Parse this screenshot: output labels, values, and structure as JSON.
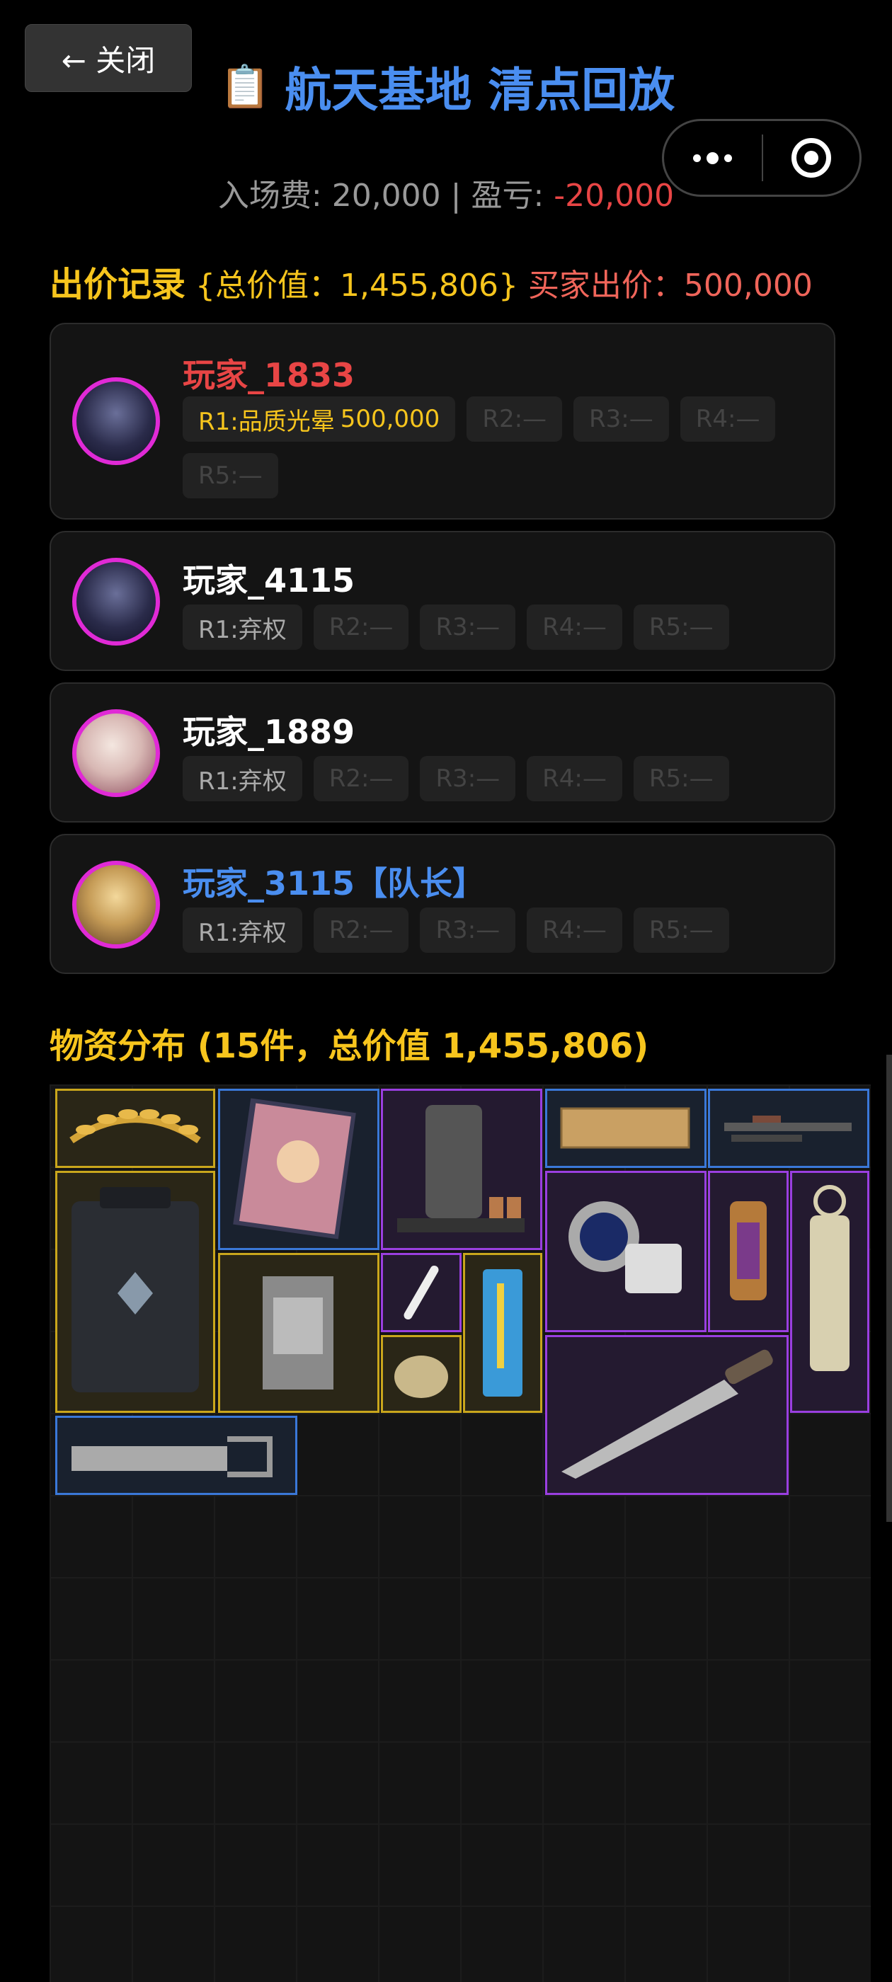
{
  "header": {
    "close_label": "← 关闭",
    "title_icon": "📋",
    "title": "航天基地 清点回放",
    "entry_fee_label": "入场费: 20,000 | 盈亏: ",
    "profit_loss": "-20,000"
  },
  "bids": {
    "heading": "出价记录",
    "total_value": "{总价值：1,455,806}",
    "buyer_bid": "买家出价：500,000",
    "players": [
      {
        "name": "玩家_1833",
        "avatar": "dark-hair-man-avatar",
        "rounds": [
          "R1:品质光晕",
          "500,000",
          "R2:—",
          "R3:—",
          "R4:—",
          "R5:—"
        ]
      },
      {
        "name": "玩家_4115",
        "avatar": "dark-hair-man-avatar",
        "rounds": [
          "R1:弃权",
          "R2:—",
          "R3:—",
          "R4:—",
          "R5:—"
        ]
      },
      {
        "name": "玩家_1889",
        "avatar": "white-hair-girl-avatar",
        "rounds": [
          "R1:弃权",
          "R2:—",
          "R3:—",
          "R4:—",
          "R5:—"
        ]
      },
      {
        "name": "玩家_3115【队长】",
        "avatar": "blonde-girl-avatar",
        "rounds": [
          "R1:弃权",
          "R2:—",
          "R3:—",
          "R4:—",
          "R5:—"
        ]
      }
    ]
  },
  "materials": {
    "heading": "物资分布 (15件，总价值 1,455,806)",
    "items": [
      {
        "name": "laurel-crown",
        "rarity": "gold"
      },
      {
        "name": "magazine",
        "rarity": "blue"
      },
      {
        "name": "coffee-machine",
        "rarity": "purple"
      },
      {
        "name": "gold-mesh-panel",
        "rarity": "blue"
      },
      {
        "name": "rifle-parts",
        "rarity": "blue"
      },
      {
        "name": "armored-case",
        "rarity": "gold"
      },
      {
        "name": "blood-pressure-monitor",
        "rarity": "purple"
      },
      {
        "name": "ornate-lantern",
        "rarity": "purple"
      },
      {
        "name": "camping-lantern",
        "rarity": "purple"
      },
      {
        "name": "document-bag",
        "rarity": "gold"
      },
      {
        "name": "electric-toothbrush",
        "rarity": "purple"
      },
      {
        "name": "medical-syringe-kit",
        "rarity": "gold"
      },
      {
        "name": "pocket-watch",
        "rarity": "gold"
      },
      {
        "name": "hunting-knife",
        "rarity": "purple"
      },
      {
        "name": "hand-saw",
        "rarity": "blue"
      }
    ]
  },
  "colors": {
    "gold": "#f7c51d",
    "red": "#e84545",
    "blue": "#4a8ef0",
    "purple_border": "#9a3fe0",
    "avatar_ring": "#e02ad6"
  }
}
